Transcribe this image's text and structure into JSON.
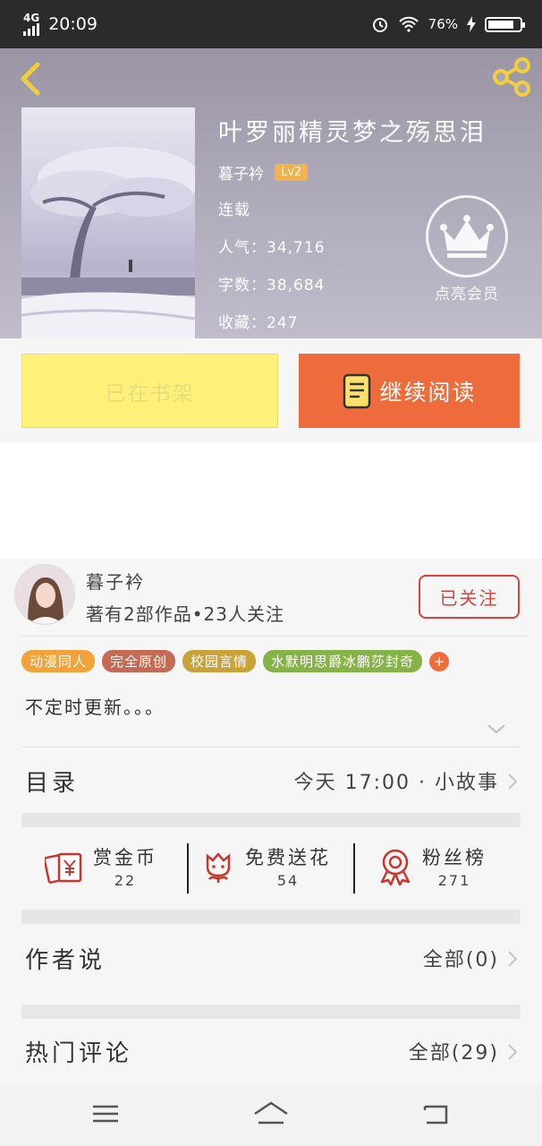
{
  "status_bar": {
    "network": "4G",
    "time": "20:09",
    "battery": "76%"
  },
  "book": {
    "title": "叶罗丽精灵梦之殇思泪",
    "author": "暮子衿",
    "level": "Lv2",
    "state": "连载",
    "popularity_label": "人气：",
    "popularity": "34,716",
    "words_label": "字数：",
    "words": "38,684",
    "favorites_label": "收藏：",
    "favorites": "247",
    "vip_label": "点亮会员"
  },
  "actions": {
    "shelf_label": "已在书架",
    "read_label": "继续阅读"
  },
  "author_card": {
    "name": "暮子衿",
    "stats": "著有2部作品•23人关注",
    "follow_label": "已关注"
  },
  "tags": [
    {
      "label": "动漫同人",
      "color": "#f3a23a"
    },
    {
      "label": "完全原创",
      "color": "#c46a55"
    },
    {
      "label": "校园言情",
      "color": "#c9a23a"
    },
    {
      "label": "水默明思爵冰鹏莎封奇",
      "color": "#86b347"
    }
  ],
  "tags_more": "+",
  "description": "不定时更新。。。",
  "catalog": {
    "title": "目录",
    "latest": "今天 17:00 · 小故事"
  },
  "rewards": [
    {
      "label": "赏金币",
      "count": "22"
    },
    {
      "label": "免费送花",
      "count": "54"
    },
    {
      "label": "粉丝榜",
      "count": "271"
    }
  ],
  "author_says": {
    "title": "作者说",
    "link": "全部(0)"
  },
  "hot_comments": {
    "title": "热门评论",
    "link": "全部(29)"
  },
  "colors": {
    "accent": "#ee6b3b",
    "shelf": "#fef17a",
    "follow": "#d8443c",
    "icon": "#c9362e"
  },
  "icons": [
    "back-arrow-icon",
    "share-icon",
    "crown-icon",
    "book-icon",
    "red-envelope-icon",
    "flower-icon",
    "ribbon-medal-icon",
    "chevron-right-icon",
    "menu-icon",
    "home-icon",
    "return-icon"
  ]
}
